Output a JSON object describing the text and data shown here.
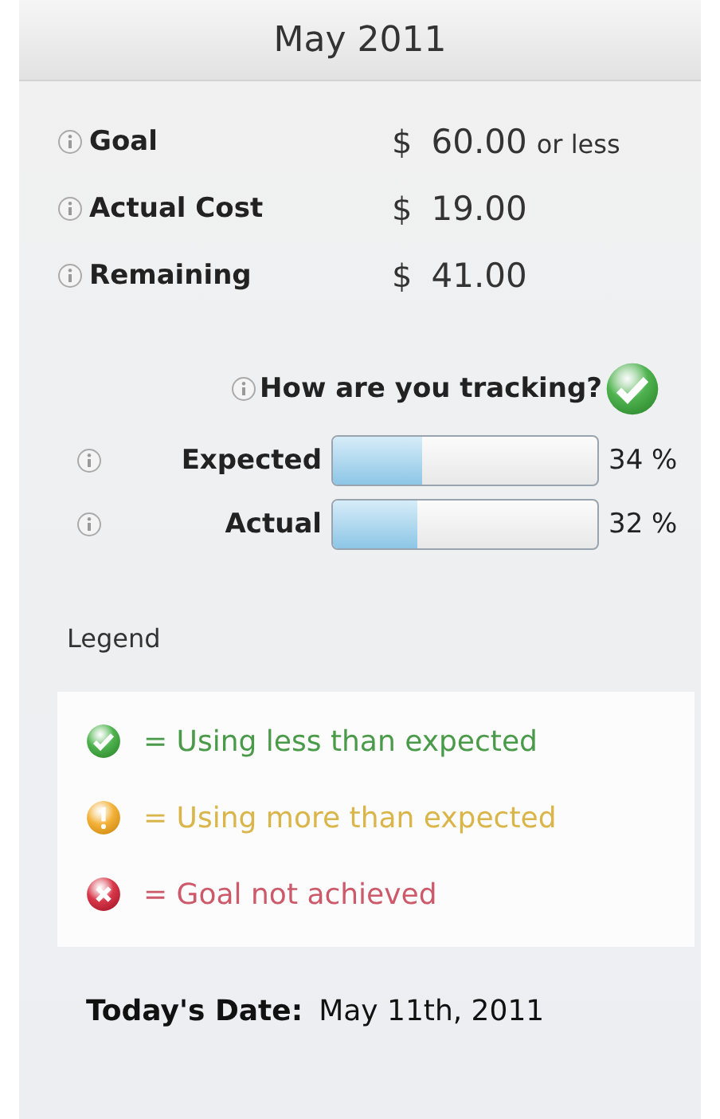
{
  "title": "May 2011",
  "summary": [
    {
      "label": "Goal",
      "amount": "$",
      "value": "60.00",
      "suffix": "or less"
    },
    {
      "label": "Actual Cost",
      "amount": "$",
      "value": "19.00"
    },
    {
      "label": "Remaining",
      "amount": "$",
      "value": "41.00"
    }
  ],
  "tracking": {
    "question": "How are you tracking?",
    "kind": "ok"
  },
  "progress": [
    {
      "label": "Expected",
      "level": 0.34,
      "reading": "34 %"
    },
    {
      "label": "Actual",
      "level": 0.32,
      "reading": "32 %"
    }
  ],
  "legend": {
    "title": "Legend",
    "items": [
      {
        "kind": "ok",
        "color": "#4a9a4a",
        "text": "= Using less than expected"
      },
      {
        "kind": "warn",
        "color": "#d9b54a",
        "text": "= Using more than expected"
      },
      {
        "kind": "fail",
        "color": "#cc5a6a",
        "text": "= Goal not achieved"
      }
    ]
  },
  "date": {
    "label": "Today's Date:",
    "value": "May 11th, 2011"
  }
}
